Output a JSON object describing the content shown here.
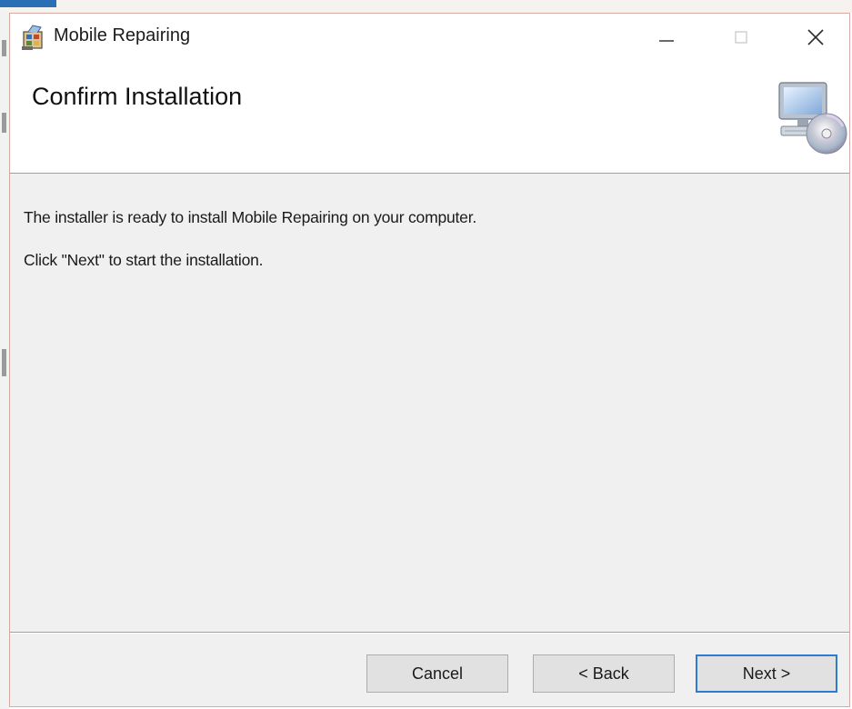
{
  "window": {
    "title": "Mobile Repairing",
    "controls": {
      "minimize_icon": "minimize-icon",
      "maximize_icon": "maximize-icon",
      "close_icon": "close-icon"
    }
  },
  "header": {
    "title": "Confirm Installation",
    "icon": "computer-disc-icon"
  },
  "body": {
    "line1": "The installer is ready to install Mobile Repairing on your computer.",
    "line2": "Click \"Next\" to start the installation."
  },
  "footer": {
    "cancel_label": "Cancel",
    "back_label": "< Back",
    "next_label": "Next >"
  },
  "colors": {
    "window_bg": "#f0f0f0",
    "header_bg": "#ffffff",
    "button_bg": "#e1e1e1",
    "default_button_border": "#2f7bd4",
    "window_border": "#d7a9a2"
  }
}
